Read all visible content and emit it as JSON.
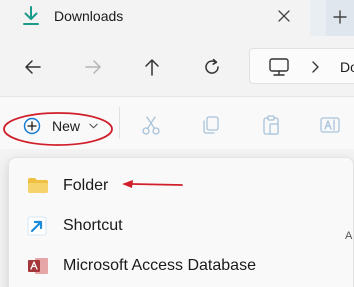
{
  "tab": {
    "title": "Downloads",
    "icon": "download-icon"
  },
  "address": {
    "partial_text": "Do"
  },
  "toolbar": {
    "new_label": "New"
  },
  "menu": {
    "items": [
      {
        "label": "Folder",
        "icon": "folder-icon"
      },
      {
        "label": "Shortcut",
        "icon": "shortcut-icon"
      },
      {
        "label": "Microsoft Access Database",
        "icon": "access-icon"
      }
    ]
  },
  "colors": {
    "accent": "#0f7ad4",
    "annotation": "#d01f2a",
    "folder": "#f0c043",
    "access": "#a4373a"
  }
}
